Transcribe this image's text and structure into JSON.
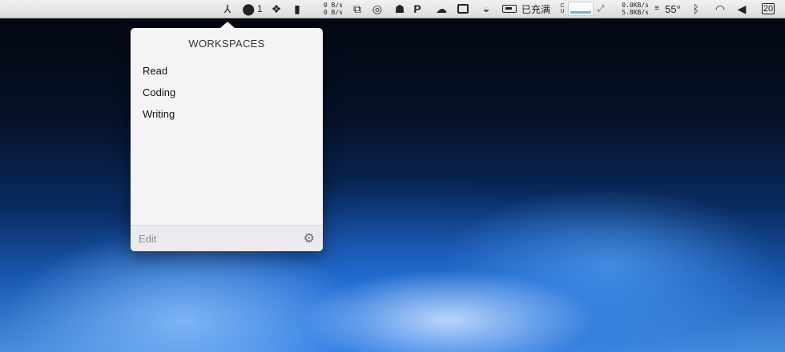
{
  "menubar": {
    "upload_rate": "0 B/s",
    "download_rate": "0 B/s",
    "notification_count": "1",
    "battery_status": "已充满",
    "net_up": "0.0KB/s",
    "net_down": "5.8KB/s",
    "temperature": "55°",
    "date_badge": "20",
    "icons": [
      "workspaces-icon",
      "shield-icon",
      "dropbox-icon",
      "audio-bars-icon",
      "copy-icon",
      "search-chat-icon",
      "person-icon",
      "p-icon",
      "wechat-icon",
      "speaker-icon",
      "bowl-icon",
      "battery-icon",
      "cpu-graph-icon",
      "arrows-icon",
      "thermometer-icon",
      "bluetooth-icon",
      "wifi-icon",
      "volume-icon",
      "calendar-icon"
    ]
  },
  "popover": {
    "title": "WORKSPACES",
    "items": [
      "Read",
      "Coding",
      "Writing"
    ],
    "edit_label": "Edit",
    "settings_icon": "gear-icon"
  },
  "colors": {
    "popover_bg": "#f6f3f7",
    "menubar_bg": "#e6e6e6",
    "muted_text": "#8d8d92"
  }
}
